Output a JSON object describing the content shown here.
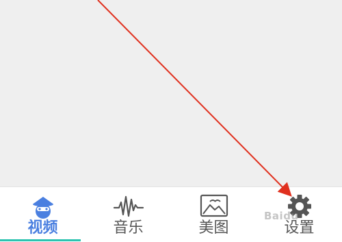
{
  "tabs": [
    {
      "label": "视频",
      "icon": "video-mascot-icon",
      "active": true
    },
    {
      "label": "音乐",
      "icon": "waveform-icon",
      "active": false
    },
    {
      "label": "美图",
      "icon": "picture-icon",
      "active": false
    },
    {
      "label": "设置",
      "icon": "gear-icon",
      "active": false
    }
  ],
  "colors": {
    "active_label": "#4a7fe0",
    "indicator": "#2bc3b0",
    "annotation_arrow": "#e0301e"
  },
  "watermark": "Baidu"
}
